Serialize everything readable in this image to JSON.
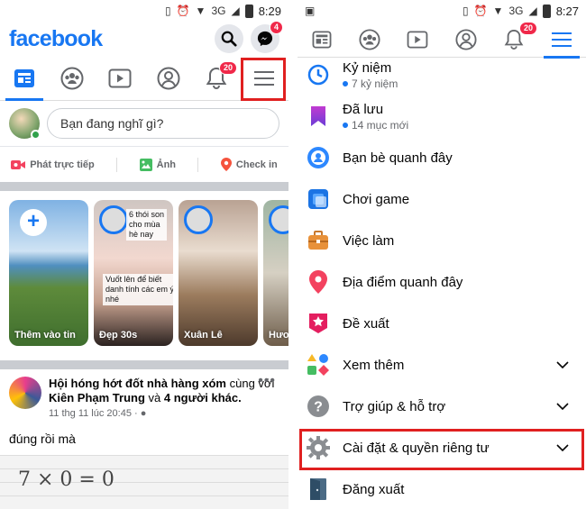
{
  "left": {
    "status": {
      "net": "3G",
      "time": "8:29"
    },
    "brand": "facebook",
    "messenger_badge": "4",
    "notif_badge": "20",
    "composer_placeholder": "Bạn đang nghĩ gì?",
    "actions": [
      "Phát trực tiếp",
      "Ảnh",
      "Check in"
    ],
    "stories": [
      {
        "label": "Thêm vào tin"
      },
      {
        "label": "Đẹp 30s",
        "overlay_top": "6 thói son\ncho mùa\nhè nay",
        "overlay_mid": "Vuốt lên để biết\ndanh tính các em ý\nnhé"
      },
      {
        "label": "Xuân Lê"
      },
      {
        "label": "Hươ"
      }
    ],
    "post": {
      "title_bold": "Hội hóng hớt đốt nhà hàng xóm",
      "with_text": "cùng với",
      "with_name": "Kiên Phạm Trung",
      "and_text": "và",
      "others": "4 người khác.",
      "meta": "11 thg 11 lúc 20:45 · ",
      "text": "đúng rồi mà",
      "image_text": "7 × 0 = 0"
    }
  },
  "right": {
    "status": {
      "net": "3G",
      "time": "8:27"
    },
    "notif_badge": "20",
    "menu": [
      {
        "icon": "memories-clock-icon",
        "label": "Kỷ niệm",
        "sub": "7 kỷ niệm"
      },
      {
        "icon": "saved-bookmark-icon",
        "label": "Đã lưu",
        "sub": "14 mục mới"
      },
      {
        "icon": "nearby-friends-icon",
        "label": "Bạn bè quanh đây"
      },
      {
        "icon": "gaming-icon",
        "label": "Chơi game"
      },
      {
        "icon": "jobs-briefcase-icon",
        "label": "Việc làm"
      },
      {
        "icon": "nearby-places-pin-icon",
        "label": "Địa điểm quanh đây"
      },
      {
        "icon": "recommendations-star-icon",
        "label": "Đề xuất"
      },
      {
        "icon": "see-more-shapes-icon",
        "label": "Xem thêm",
        "chevron": true
      },
      {
        "icon": "help-question-icon",
        "label": "Trợ giúp & hỗ trợ",
        "chevron": true
      },
      {
        "icon": "settings-gear-icon",
        "label": "Cài đặt & quyền riêng tư",
        "chevron": true
      },
      {
        "icon": "logout-door-icon",
        "label": "Đăng xuất"
      }
    ]
  },
  "colors": {
    "brand": "#1877f2",
    "highlight": "#e02020",
    "badge": "#f02849"
  }
}
